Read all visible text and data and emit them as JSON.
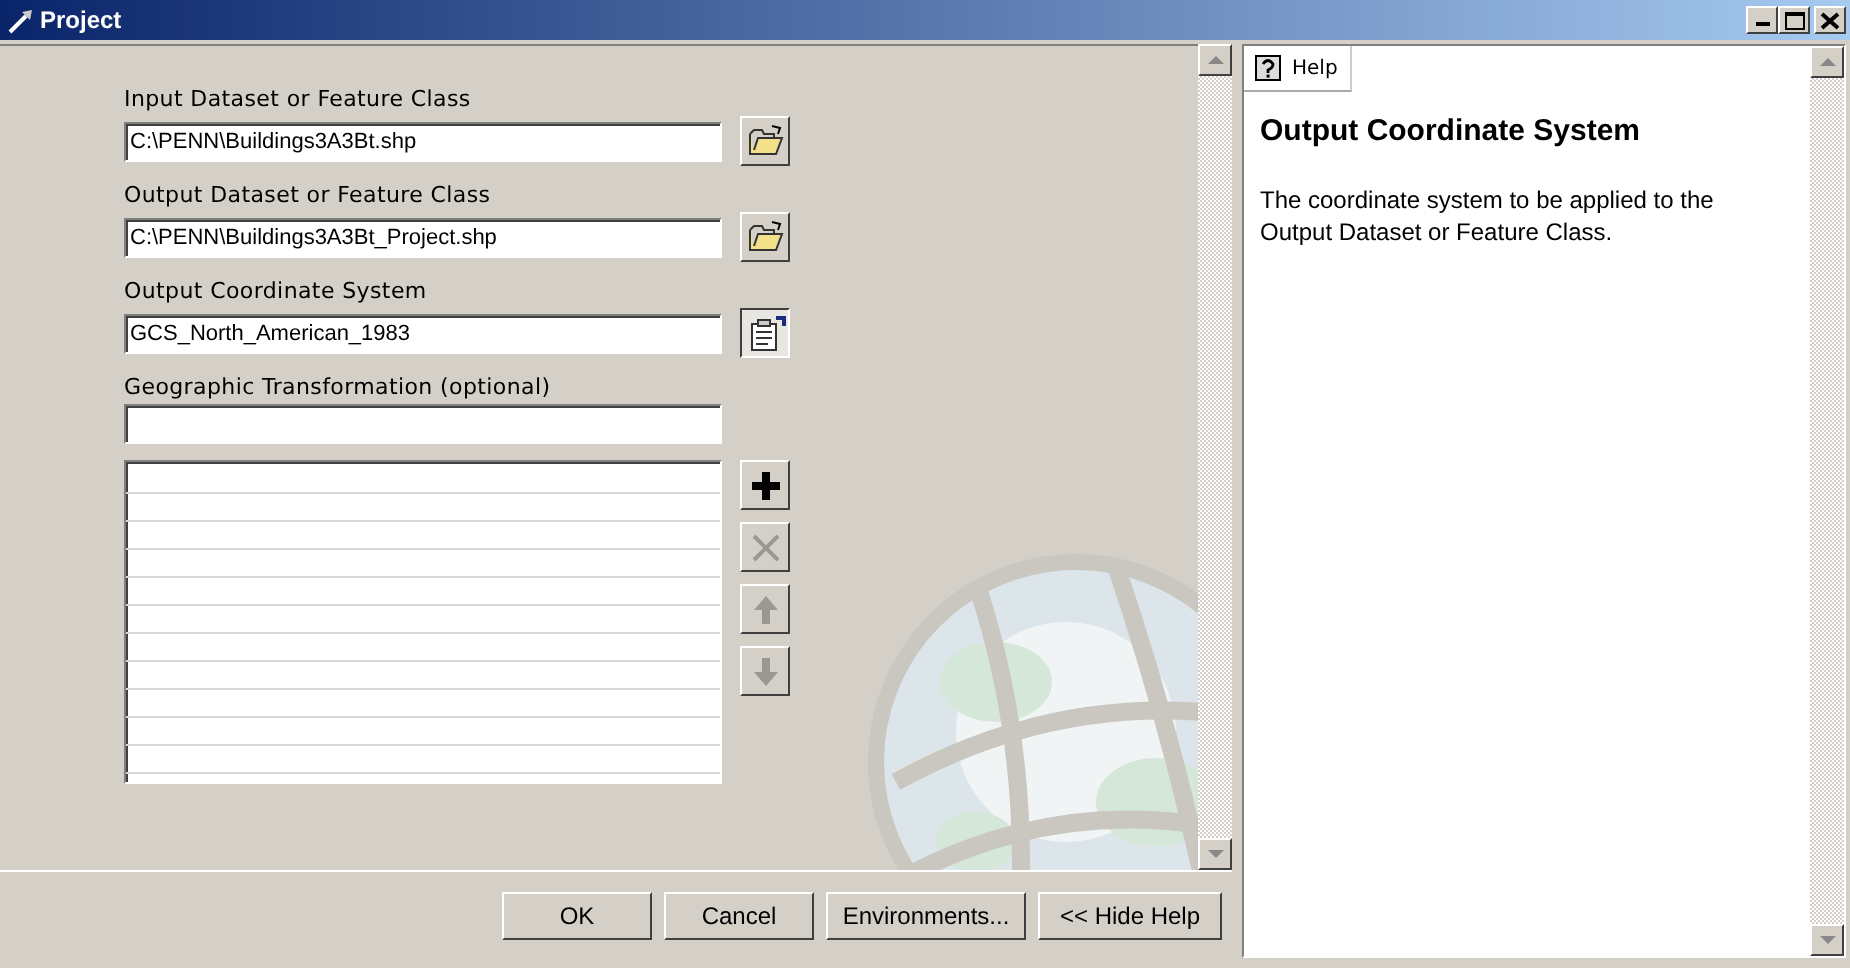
{
  "window": {
    "title": "Project"
  },
  "fields": [
    {
      "label": "Input Dataset or Feature Class",
      "value": "C:\\PENN\\Buildings3A3Bt.shp",
      "kind": "browse"
    },
    {
      "label": "Output Dataset or Feature Class",
      "value": "C:\\PENN\\Buildings3A3Bt_Project.shp",
      "kind": "browse"
    },
    {
      "label": "Output Coordinate System",
      "value": "GCS_North_American_1983",
      "kind": "properties"
    },
    {
      "label": "Geographic Transformation (optional)",
      "kind": "list"
    }
  ],
  "list_tools": [
    {
      "kind": "add",
      "disabled": false
    },
    {
      "kind": "remove",
      "disabled": true
    },
    {
      "kind": "up",
      "disabled": true
    },
    {
      "kind": "down",
      "disabled": true
    }
  ],
  "buttons": [
    "OK",
    "Cancel",
    "Environments...",
    "<< Hide Help"
  ],
  "help": {
    "tab": "Help",
    "heading": "Output Coordinate System",
    "text": "The coordinate system to be applied to the Output Dataset or Feature Class."
  }
}
